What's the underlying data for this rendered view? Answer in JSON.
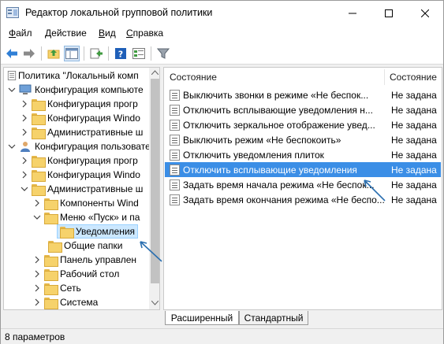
{
  "window": {
    "title": "Редактор локальной групповой политики"
  },
  "menu": [
    {
      "label": "Файл",
      "underline": "Ф",
      "rest": "айл"
    },
    {
      "label": "Действие",
      "underline": "Д",
      "rest": "ействие"
    },
    {
      "label": "Вид",
      "underline": "В",
      "rest": "ид"
    },
    {
      "label": "Справка",
      "underline": "С",
      "rest": "правка"
    }
  ],
  "toolbar": {
    "icons": [
      "back-arrow-icon",
      "forward-arrow-icon",
      "up-folder-icon",
      "show-hide-tree-icon",
      "export-list-icon",
      "help-icon",
      "properties-icon",
      "filter-icon"
    ]
  },
  "tree": {
    "items": [
      {
        "label": "Политика \"Локальный компьютер\"",
        "display": "Политика \"Локальный комп"
      },
      {
        "label": "Конфигурация компьютера",
        "display": "Конфигурация компьюте"
      },
      {
        "label": "Конфигурация программ",
        "display": "Конфигурация прогр"
      },
      {
        "label": "Конфигурация Windows",
        "display": "Конфигурация Windo"
      },
      {
        "label": "Административные шаблоны",
        "display": "Административные ш"
      },
      {
        "label": "Конфигурация пользователя",
        "display": "Конфигурация пользовате"
      },
      {
        "label": "Конфигурация программ",
        "display": "Конфигурация прогр"
      },
      {
        "label": "Конфигурация Windows",
        "display": "Конфигурация Windo"
      },
      {
        "label": "Административные шаблоны",
        "display": "Административные ш"
      },
      {
        "label": "Компоненты Windows",
        "display": "Компоненты Wind"
      },
      {
        "label": "Меню «Пуск» и панель задач",
        "display": "Меню «Пуск» и па"
      },
      {
        "label": "Уведомления",
        "display": "Уведомления"
      },
      {
        "label": "Общие папки",
        "display": "Общие папки"
      },
      {
        "label": "Панель управления",
        "display": "Панель управлен"
      },
      {
        "label": "Рабочий стол",
        "display": "Рабочий стол"
      },
      {
        "label": "Сеть",
        "display": "Сеть"
      },
      {
        "label": "Система",
        "display": "Система"
      }
    ]
  },
  "list": {
    "columns": {
      "name": "Состояние",
      "state": "Состояние"
    },
    "rows": [
      {
        "name": "Выключить звонки в режиме «Не беспок...",
        "state": "Не задана"
      },
      {
        "name": "Отключить всплывающие уведомления н...",
        "state": "Не задана"
      },
      {
        "name": "Отключить зеркальное отображение увед...",
        "state": "Не задана"
      },
      {
        "name": "Выключить режим «Не беспокоить»",
        "state": "Не задана"
      },
      {
        "name": "Отключить уведомления плиток",
        "state": "Не задана"
      },
      {
        "name": "Отключить всплывающие уведомления",
        "state": "Не задана",
        "selected": true
      },
      {
        "name": "Задать время начала режима «Не беспок...",
        "state": "Не задана"
      },
      {
        "name": "Задать время окончания режима «Не беспо...",
        "state": "Не задана"
      }
    ]
  },
  "tabs": [
    {
      "label": "Расширенный"
    },
    {
      "label": "Стандартный"
    }
  ],
  "status": {
    "text": "8 параметров"
  },
  "colors": {
    "selection": "#3b8ee6",
    "tree_selection": "#cce8ff",
    "annotation_arrow": "#2a6fb0"
  }
}
